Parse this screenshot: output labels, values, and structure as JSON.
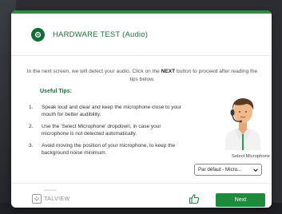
{
  "header": {
    "title": "HARDWARE TEST (Audio)",
    "icon": "webcam-icon"
  },
  "intro": {
    "part1": "In the next screen, we will detect your audio. Click on the ",
    "bold": "NEXT",
    "part2": " button to proceed after reading the tips below."
  },
  "tips": {
    "title": "Useful Tips:",
    "items": [
      {
        "num": "1.",
        "text": "Speak loud and clear and keep the microphone close to your mouth for better audibility."
      },
      {
        "num": "2.",
        "text": "Use the 'Select Microphone' dropdown, in case your microphone is not detected automatically."
      },
      {
        "num": "3.",
        "text": "Avoid moving the position of your microphone, to keep the background noise minimum."
      }
    ]
  },
  "microphone": {
    "label": "Select Microphone",
    "selected": "Par défaut - Micro..."
  },
  "footer": {
    "brand": "TALVIEW",
    "brand_small": "powered by",
    "next_label": "Next"
  },
  "colors": {
    "accent": "#1e8a3b",
    "title": "#1f6f3a",
    "top_bar": "#2e8b3d"
  }
}
